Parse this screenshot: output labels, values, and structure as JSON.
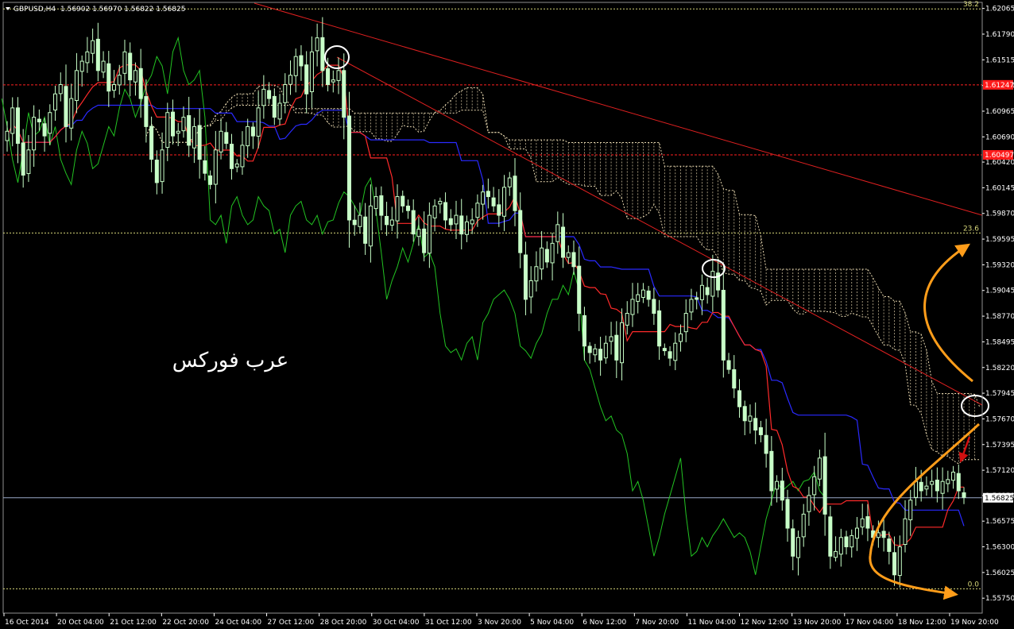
{
  "header": {
    "symbol": "GBPUSD,H4",
    "ohlc": "1.56902 1.56970 1.56822 1.56825"
  },
  "watermark": "عرب فوركس",
  "colors": {
    "background": "#000000",
    "bull": "#c8ffc8",
    "bear": "#c8ffc8",
    "tenkan": "#ff2a2a",
    "kijun": "#2a2aff",
    "chikou": "#22c322",
    "cloud": "#e8d8b0",
    "trendline": "#e02020",
    "fib": "#d8d87a",
    "level_red": "#ff2020",
    "annotation_arrow": "#ff9d1a",
    "annotation_circle": "#ffffff",
    "price_line": "#9aa8c8",
    "axis": "#ffffff"
  },
  "chart_data": {
    "type": "candlestick",
    "symbol": "GBPUSD",
    "timeframe": "H4",
    "ylim": [
      1.5559,
      1.6213
    ],
    "y_ticks": [
      "1.62065",
      "1.61790",
      "1.61515",
      "1.61240",
      "1.60965",
      "1.60690",
      "1.60420",
      "1.60145",
      "1.59870",
      "1.59595",
      "1.59320",
      "1.59045",
      "1.58770",
      "1.58495",
      "1.58220",
      "1.57945",
      "1.57670",
      "1.57395",
      "1.57120",
      "1.56850",
      "1.56575",
      "1.56300",
      "1.56025",
      "1.55750"
    ],
    "x_ticks": [
      "16 Oct 2014",
      "20 Oct 04:00",
      "21 Oct 12:00",
      "22 Oct 20:00",
      "24 Oct 04:00",
      "27 Oct 12:00",
      "28 Oct 20:00",
      "30 Oct 04:00",
      "31 Oct 12:00",
      "3 Nov 20:00",
      "5 Nov 04:00",
      "6 Nov 12:00",
      "7 Nov 20:00",
      "11 Nov 04:00",
      "12 Nov 12:00",
      "13 Nov 20:00",
      "17 Nov 04:00",
      "18 Nov 12:00",
      "19 Nov 20:00"
    ],
    "price_labels": {
      "current": "1.56825",
      "level_1": "1.61247",
      "level_2": "1.60497"
    },
    "fib_labels": [
      "38.2",
      "23.6",
      "0.0"
    ],
    "levels": {
      "fib_382": 1.6206,
      "fib_236": 1.5966,
      "fib_0": 1.5585,
      "red_upper": 1.61247,
      "red_lower": 1.60497,
      "current": 1.56825
    },
    "closes": [
      1.6075,
      1.61,
      1.6062,
      1.6028,
      1.6055,
      1.609,
      1.6085,
      1.607,
      1.6095,
      1.6115,
      1.6125,
      1.608,
      1.611,
      1.614,
      1.615,
      1.616,
      1.6172,
      1.614,
      1.615,
      1.6118,
      1.6125,
      1.6135,
      1.616,
      1.613,
      1.614,
      1.611,
      1.608,
      1.6045,
      1.602,
      1.6055,
      1.6095,
      1.607,
      1.6075,
      1.609,
      1.606,
      1.608,
      1.6045,
      1.603,
      1.6018,
      1.6055,
      1.6075,
      1.6062,
      1.6035,
      1.604,
      1.606,
      1.608,
      1.607,
      1.61,
      1.612,
      1.611,
      1.609,
      1.6105,
      1.6125,
      1.6135,
      1.6155,
      1.6145,
      1.6115,
      1.616,
      1.6175,
      1.614,
      1.6125,
      1.613,
      1.614,
      1.609,
      1.598,
      1.5975,
      1.5985,
      1.5955,
      1.5995,
      1.6005,
      1.5985,
      1.5975,
      1.598,
      1.6005,
      1.5995,
      1.599,
      1.5965,
      1.597,
      1.5945,
      1.5985,
      1.5995,
      1.6,
      1.598,
      1.5975,
      1.5985,
      1.5965,
      1.5978,
      1.598,
      1.5998,
      1.601,
      1.6005,
      1.5995,
      1.5985,
      1.6015,
      1.6025,
      1.599,
      1.5945,
      1.5895,
      1.5915,
      1.593,
      1.595,
      1.5935,
      1.5955,
      1.5975,
      1.594,
      1.5945,
      1.593,
      1.588,
      1.5845,
      1.5838,
      1.5842,
      1.583,
      1.5848,
      1.5855,
      1.583,
      1.587,
      1.588,
      1.5895,
      1.59,
      1.5905,
      1.5895,
      1.588,
      1.5845,
      1.584,
      1.5832,
      1.5848,
      1.5858,
      1.588,
      1.5895,
      1.5895,
      1.591,
      1.59,
      1.5925,
      1.5905,
      1.583,
      1.582,
      1.58,
      1.578,
      1.5765,
      1.577,
      1.5755,
      1.575,
      1.573,
      1.569,
      1.57,
      1.568,
      1.565,
      1.562,
      1.564,
      1.5665,
      1.5685,
      1.5705,
      1.5725,
      1.5665,
      1.562,
      1.5625,
      1.564,
      1.563,
      1.5642,
      1.565,
      1.566,
      1.565,
      1.564,
      1.5645,
      1.564,
      1.5625,
      1.56,
      1.563,
      1.566,
      1.568,
      1.57,
      1.569,
      1.5695,
      1.57,
      1.569,
      1.57,
      1.5702,
      1.571,
      1.569,
      1.5683
    ],
    "annotations": [
      "resistance-circle-28-oct",
      "resistance-circle-12-nov",
      "cloud-test-circle-right",
      "orange-up-scenario-arrow",
      "orange-down-scenario-arrow",
      "red-down-arrow"
    ]
  }
}
